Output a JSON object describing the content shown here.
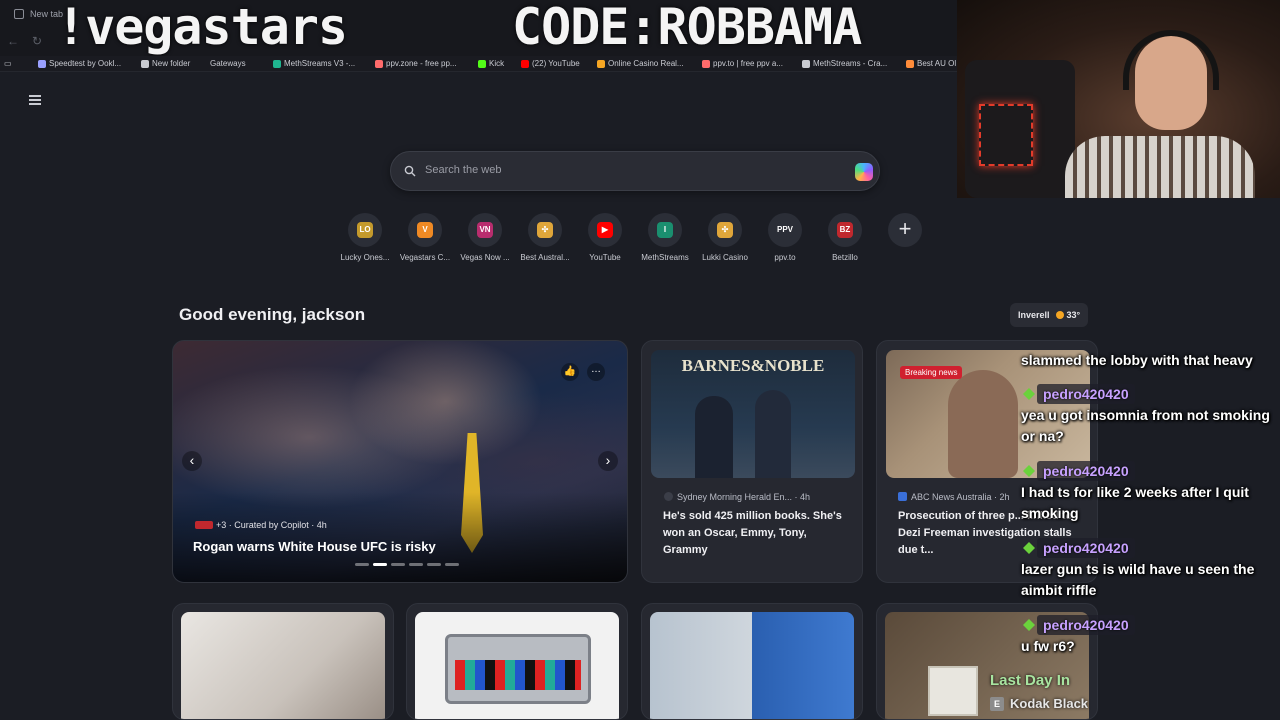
{
  "browser": {
    "tab_title": "New tab"
  },
  "overlay": {
    "left_text": "!vegastars",
    "right_text": "CODE:ROBBAMA"
  },
  "bookmarks": [
    {
      "label": "Speedtest by Ookl...",
      "icon": "speedtest-icon",
      "color": "#9aa0ff"
    },
    {
      "label": "New folder",
      "icon": "folder-icon",
      "color": "#c9cbd2"
    },
    {
      "label": "Gateways",
      "icon": "",
      "color": ""
    },
    {
      "label": "MethStreams V3 -...",
      "icon": "methstreams-icon",
      "color": "#1fb58f"
    },
    {
      "label": "ppv.zone - free pp...",
      "icon": "ppv-zone-icon",
      "color": "#ff6b6b"
    },
    {
      "label": "Kick",
      "icon": "kick-icon",
      "color": "#53fc18"
    },
    {
      "label": "(22) YouTube",
      "icon": "youtube-icon",
      "color": "#ff0000"
    },
    {
      "label": "Online Casino Real...",
      "icon": "casino-icon",
      "color": "#f5a623"
    },
    {
      "label": "ppv.to | free ppv a...",
      "icon": "ppv-to-icon",
      "color": "#ff6b6b"
    },
    {
      "label": "MethStreams - Cra...",
      "icon": "globe-icon",
      "color": "#c9cbd2"
    },
    {
      "label": "Best AU Ol",
      "icon": "casino-icon",
      "color": "#ff8c3a"
    }
  ],
  "search": {
    "placeholder": "Search the web"
  },
  "shortcuts": [
    {
      "label": "Lucky Ones...",
      "glyph": "LO",
      "color": "#c49a2c"
    },
    {
      "label": "Vegastars C...",
      "glyph": "V",
      "color": "#f08a24"
    },
    {
      "label": "Vegas Now ...",
      "glyph": "VN",
      "color": "#b82d6e"
    },
    {
      "label": "Best Austral...",
      "glyph": "✣",
      "color": "#e0a63a"
    },
    {
      "label": "YouTube",
      "glyph": "▶",
      "color": "#ff0000"
    },
    {
      "label": "MethStreams",
      "glyph": "I",
      "color": "#1a8f6f"
    },
    {
      "label": "Lukki Casino",
      "glyph": "✣",
      "color": "#e0a63a"
    },
    {
      "label": "ppv.to",
      "glyph": "PPV",
      "color": "#2b2e37"
    },
    {
      "label": "Betzillo",
      "glyph": "BZ",
      "color": "#c0282e"
    }
  ],
  "greeting": "Good evening, jackson",
  "weather": {
    "location": "Inverell",
    "temp": "33°"
  },
  "hero": {
    "meta": "+3 · Curated by Copilot · 4h",
    "title": "Rogan warns White House UFC is risky",
    "carousel_index": 2,
    "carousel_count": 6
  },
  "news": [
    {
      "image_text": "BARNES&NOBLE",
      "source": "Sydney Morning Herald En... · 4h",
      "title": "He's sold 425 million books. She's won an Oscar, Emmy, Tony, Grammy"
    },
    {
      "badge": "Breaking news",
      "source": "ABC News Australia · 2h",
      "title": "Prosecution of three p... linked to Dezi Freeman investigation stalls due t..."
    }
  ],
  "chat": [
    {
      "user": "",
      "text": "slammed the lobby with that heavy"
    },
    {
      "user": "pedro420420",
      "text": "yea u got insomnia from not smoking or na?"
    },
    {
      "user": "pedro420420",
      "text": "I had ts for like 2 weeks after I quit smoking"
    },
    {
      "user": "pedro420420",
      "text": "lazer gun ts is wild have u seen the aimbit riffle"
    },
    {
      "user": "pedro420420",
      "text": "u fw r6?"
    }
  ],
  "now_playing": {
    "song": "Last Day In",
    "explicit": "E",
    "artist": "Kodak Black"
  },
  "colors": {
    "page_bg": "#1b1d24",
    "card_bg": "#262830",
    "chat_username": "#c7a1ff",
    "now_playing_song": "#a8e4a0"
  }
}
